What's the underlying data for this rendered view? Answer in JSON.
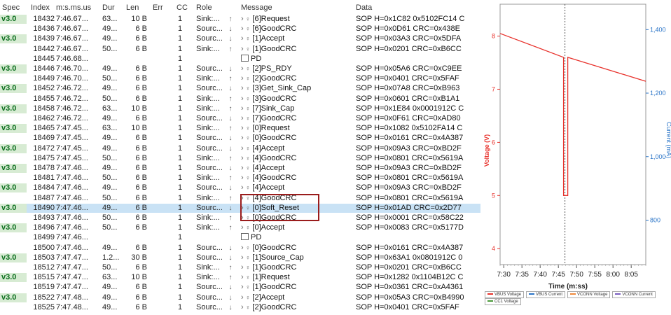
{
  "columns": [
    "Spec",
    "Index",
    "m:s.ms.us",
    "Dur",
    "Len",
    "Err",
    "CC",
    "Role",
    "Message",
    "Data"
  ],
  "rows": [
    {
      "spec": "v3.0",
      "index": "18432",
      "time": "7:46.67...",
      "dur": "63...",
      "len": "10 B",
      "cc": "1",
      "role": "Sink:...",
      "arrow": "↑",
      "msg": "[6]Request",
      "data": "SOP H=0x1C82 0x5102FC14 C"
    },
    {
      "spec": "",
      "index": "18436",
      "time": "7:46.67...",
      "dur": "49...",
      "len": "6 B",
      "cc": "1",
      "role": "Sourc...",
      "arrow": "↓",
      "msg": "[6]GoodCRC",
      "data": "SOP H=0x0D61 CRC=0x438E"
    },
    {
      "spec": "v3.0",
      "index": "18439",
      "time": "7:46.67...",
      "dur": "49...",
      "len": "6 B",
      "cc": "1",
      "role": "Sourc...",
      "arrow": "↓",
      "msg": "[1]Accept",
      "data": "SOP H=0x03A3 CRC=0x5DFA"
    },
    {
      "spec": "",
      "index": "18442",
      "time": "7:46.67...",
      "dur": "50...",
      "len": "6 B",
      "cc": "1",
      "role": "Sink:...",
      "arrow": "↑",
      "msg": "[1]GoodCRC",
      "data": "SOP H=0x0201 CRC=0xB6CC"
    },
    {
      "spec": "",
      "index": "18445",
      "time": "7:46.68...",
      "dur": "",
      "len": "",
      "cc": "1",
      "role": "",
      "arrow": "",
      "msg": "PD",
      "data": "",
      "pd": true
    },
    {
      "spec": "v3.0",
      "index": "18446",
      "time": "7:46.70...",
      "dur": "49...",
      "len": "6 B",
      "cc": "1",
      "role": "Sourc...",
      "arrow": "↓",
      "msg": "[2]PS_RDY",
      "data": "SOP H=0x05A6 CRC=0xC9EE"
    },
    {
      "spec": "",
      "index": "18449",
      "time": "7:46.70...",
      "dur": "50...",
      "len": "6 B",
      "cc": "1",
      "role": "Sink:...",
      "arrow": "↑",
      "msg": "[2]GoodCRC",
      "data": "SOP H=0x0401 CRC=0x5FAF"
    },
    {
      "spec": "v3.0",
      "index": "18452",
      "time": "7:46.72...",
      "dur": "49...",
      "len": "6 B",
      "cc": "1",
      "role": "Sourc...",
      "arrow": "↓",
      "msg": "[3]Get_Sink_Cap",
      "data": "SOP H=0x07A8 CRC=0xB963"
    },
    {
      "spec": "",
      "index": "18455",
      "time": "7:46.72...",
      "dur": "50...",
      "len": "6 B",
      "cc": "1",
      "role": "Sink:...",
      "arrow": "↑",
      "msg": "[3]GoodCRC",
      "data": "SOP H=0x0601 CRC=0xB1A1"
    },
    {
      "spec": "v3.0",
      "index": "18458",
      "time": "7:46.72...",
      "dur": "63...",
      "len": "10 B",
      "cc": "1",
      "role": "Sink:...",
      "arrow": "↑",
      "msg": "[7]Sink_Cap",
      "data": "SOP H=0x1E84 0x0001912C C"
    },
    {
      "spec": "",
      "index": "18462",
      "time": "7:46.72...",
      "dur": "49...",
      "len": "6 B",
      "cc": "1",
      "role": "Sourc...",
      "arrow": "↓",
      "msg": "[7]GoodCRC",
      "data": "SOP H=0x0F61 CRC=0xAD80"
    },
    {
      "spec": "v3.0",
      "index": "18465",
      "time": "7:47.45...",
      "dur": "63...",
      "len": "10 B",
      "cc": "1",
      "role": "Sink:...",
      "arrow": "↑",
      "msg": "[0]Request",
      "data": "SOP H=0x1082 0x5102FA14 C"
    },
    {
      "spec": "",
      "index": "18469",
      "time": "7:47.45...",
      "dur": "49...",
      "len": "6 B",
      "cc": "1",
      "role": "Sourc...",
      "arrow": "↓",
      "msg": "[0]GoodCRC",
      "data": "SOP H=0x0161 CRC=0x4A387"
    },
    {
      "spec": "v3.0",
      "index": "18472",
      "time": "7:47.45...",
      "dur": "49...",
      "len": "6 B",
      "cc": "1",
      "role": "Sourc...",
      "arrow": "↓",
      "msg": "[4]Accept",
      "data": "SOP H=0x09A3 CRC=0xBD2F"
    },
    {
      "spec": "",
      "index": "18475",
      "time": "7:47.45...",
      "dur": "50...",
      "len": "6 B",
      "cc": "1",
      "role": "Sink:...",
      "arrow": "↑",
      "msg": "[4]GoodCRC",
      "data": "SOP H=0x0801 CRC=0x5619A"
    },
    {
      "spec": "v3.0",
      "index": "18478",
      "time": "7:47.46...",
      "dur": "49...",
      "len": "6 B",
      "cc": "1",
      "role": "Sourc...",
      "arrow": "↓",
      "msg": "[4]Accept",
      "data": "SOP H=0x09A3 CRC=0xBD2F"
    },
    {
      "spec": "",
      "index": "18481",
      "time": "7:47.46...",
      "dur": "50...",
      "len": "6 B",
      "cc": "1",
      "role": "Sink:...",
      "arrow": "↑",
      "msg": "[4]GoodCRC",
      "data": "SOP H=0x0801 CRC=0x5619A"
    },
    {
      "spec": "v3.0",
      "index": "18484",
      "time": "7:47.46...",
      "dur": "49...",
      "len": "6 B",
      "cc": "1",
      "role": "Sourc...",
      "arrow": "↓",
      "msg": "[4]Accept",
      "data": "SOP H=0x09A3 CRC=0xBD2F"
    },
    {
      "spec": "",
      "index": "18487",
      "time": "7:47.46...",
      "dur": "50...",
      "len": "6 B",
      "cc": "1",
      "role": "Sink:...",
      "arrow": "↑",
      "msg": "[4]GoodCRC",
      "data": "SOP H=0x0801 CRC=0x5619A"
    },
    {
      "spec": "v3.0",
      "index": "18490",
      "time": "7:47.46...",
      "dur": "49...",
      "len": "6 B",
      "cc": "1",
      "role": "Sourc...",
      "arrow": "↓",
      "msg": "[0]Soft_Reset",
      "data": "SOP H=0x01AD CRC=0x2D77",
      "selected": true
    },
    {
      "spec": "",
      "index": "18493",
      "time": "7:47.46...",
      "dur": "50...",
      "len": "6 B",
      "cc": "1",
      "role": "Sink:...",
      "arrow": "↑",
      "msg": "[0]GoodCRC",
      "data": "SOP H=0x0001 CRC=0x58C22"
    },
    {
      "spec": "v3.0",
      "index": "18496",
      "time": "7:47.46...",
      "dur": "50...",
      "len": "6 B",
      "cc": "1",
      "role": "Sink:...",
      "arrow": "↑",
      "msg": "[0]Accept",
      "data": "SOP H=0x0083 CRC=0x5177D"
    },
    {
      "spec": "",
      "index": "18499",
      "time": "7:47.46...",
      "dur": "",
      "len": "",
      "cc": "1",
      "role": "",
      "arrow": "",
      "msg": "PD",
      "data": "",
      "pd": true
    },
    {
      "spec": "",
      "index": "18500",
      "time": "7:47.46...",
      "dur": "49...",
      "len": "6 B",
      "cc": "1",
      "role": "Sourc...",
      "arrow": "↓",
      "msg": "[0]GoodCRC",
      "data": "SOP H=0x0161 CRC=0x4A387"
    },
    {
      "spec": "v3.0",
      "index": "18503",
      "time": "7:47.47...",
      "dur": "1.2...",
      "len": "30 B",
      "cc": "1",
      "role": "Sourc...",
      "arrow": "↓",
      "msg": "[1]Source_Cap",
      "data": "SOP H=0x63A1 0x0801912C 0"
    },
    {
      "spec": "",
      "index": "18512",
      "time": "7:47.47...",
      "dur": "50...",
      "len": "6 B",
      "cc": "1",
      "role": "Sink:...",
      "arrow": "↑",
      "msg": "[1]GoodCRC",
      "data": "SOP H=0x0201 CRC=0xB6CC"
    },
    {
      "spec": "v3.0",
      "index": "18515",
      "time": "7:47.47...",
      "dur": "63...",
      "len": "10 B",
      "cc": "1",
      "role": "Sink:...",
      "arrow": "↑",
      "msg": "[1]Request",
      "data": "SOP H=0x1282 0x1104B12C C"
    },
    {
      "spec": "",
      "index": "18519",
      "time": "7:47.47...",
      "dur": "49...",
      "len": "6 B",
      "cc": "1",
      "role": "Sourc...",
      "arrow": "↓",
      "msg": "[1]GoodCRC",
      "data": "SOP H=0x0361 CRC=0xA4361"
    },
    {
      "spec": "v3.0",
      "index": "18522",
      "time": "7:47.48...",
      "dur": "49...",
      "len": "6 B",
      "cc": "1",
      "role": "Sourc...",
      "arrow": "↓",
      "msg": "[2]Accept",
      "data": "SOP H=0x05A3 CRC=0xB4990"
    },
    {
      "spec": "",
      "index": "18525",
      "time": "7:47.48...",
      "dur": "49...",
      "len": "6 B",
      "cc": "1",
      "role": "Sourc...",
      "arrow": "↓",
      "msg": "[2]GoodCRC",
      "data": "SOP H=0x0401 CRC=0x5FAF"
    }
  ],
  "chart": {
    "yleft_label": "Voltage (V)",
    "yright_label": "Current (mA)",
    "xlabel": "Time (m:ss)",
    "yleft_ticks": [
      "8",
      "7",
      "6",
      "5",
      "4"
    ],
    "yright_ticks": [
      "1,400",
      "1,200",
      "1,000",
      "800"
    ],
    "x_ticks": [
      "7:30",
      "7:35",
      "7:40",
      "7:45",
      "7:50",
      "7:55",
      "8:00",
      "8:05"
    ],
    "legend": [
      "VBUS Voltage",
      "VBUS Current",
      "VCONN Voltage",
      "VCONN Current",
      "CC1 Voltage"
    ],
    "colors": {
      "vbus_voltage": "#e8322c",
      "vbus_current": "#2a74c7",
      "vconn_voltage": "#f08a3c",
      "vconn_current": "#7a5fc0",
      "cc1_voltage": "#4a9a3a",
      "cursor": "#555555"
    }
  },
  "chart_data": {
    "type": "line",
    "xlabel": "Time (m:ss)",
    "ylabel": "Voltage (V)",
    "y2label": "Current (mA)",
    "ylim": [
      3.7,
      8.6
    ],
    "series": [
      {
        "name": "VBUS Voltage",
        "x": [
          "7:29",
          "7:47",
          "7:47",
          "7:47",
          "7:47",
          "7:47",
          "8:09"
        ],
        "values": [
          8.05,
          7.6,
          7.6,
          5.0,
          5.0,
          7.6,
          7.15
        ]
      }
    ]
  }
}
